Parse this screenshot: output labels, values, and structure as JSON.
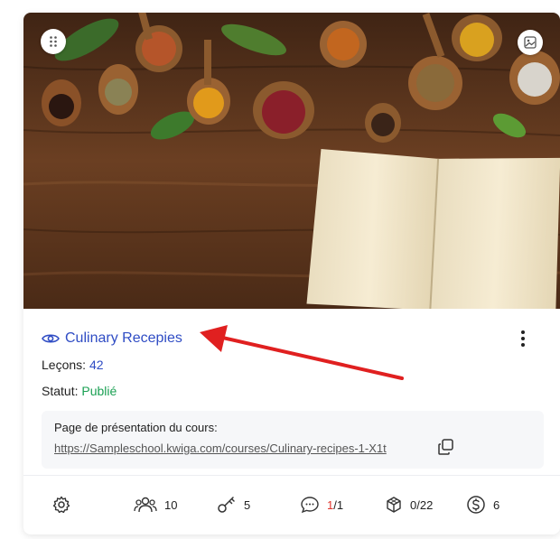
{
  "course": {
    "title": "Culinary Recepies",
    "lessons_label": "Leçons:",
    "lessons_value": "42",
    "status_label": "Statut:",
    "status_value": "Publié",
    "presentation_label": "Page de présentation du cours:",
    "presentation_url": "https://Sampleschool.kwiga.com/courses/Culinary-recipes-1-X1t"
  },
  "stats": {
    "students": "10",
    "keys": "5",
    "comments_current": "1",
    "comments_total": "/1",
    "tests": "0/22",
    "payments": "6"
  },
  "icons": {
    "drag": "drag-dots-icon",
    "image": "image-icon",
    "eye": "eye-icon",
    "more": "kebab-menu-icon",
    "copy": "copy-icon",
    "settings": "gear-icon",
    "students": "users-icon",
    "keys": "key-icon",
    "comments": "chat-bubble-icon",
    "tests": "cube-icon",
    "payments": "dollar-circle-icon"
  },
  "colors": {
    "link_blue": "#2f4cc4",
    "status_green": "#1aa053",
    "alert_red": "#e0342c",
    "annotation_arrow": "#e02020"
  }
}
